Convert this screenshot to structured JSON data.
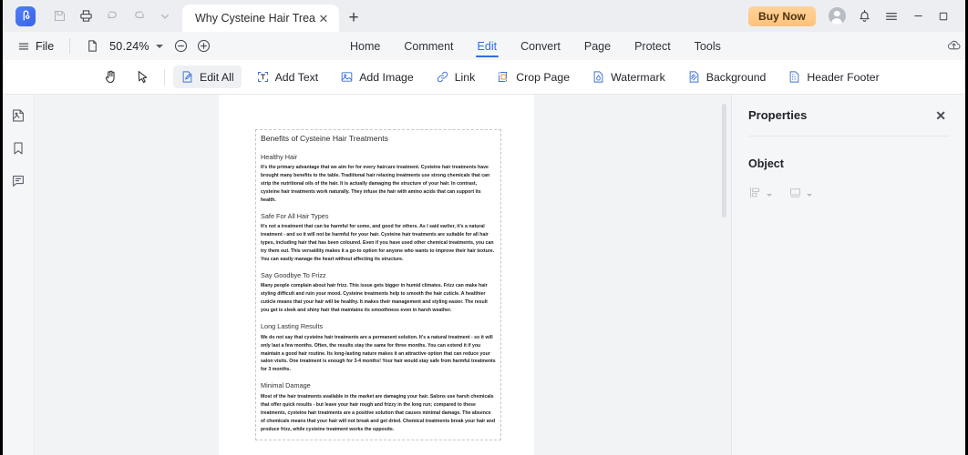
{
  "window": {
    "titlebar": {
      "logo_icon": "pdfelement-logo-icon",
      "quick_actions": [
        {
          "name": "save-icon",
          "label": "Save",
          "enabled": false
        },
        {
          "name": "print-icon",
          "label": "Print",
          "enabled": true
        },
        {
          "name": "undo-icon",
          "label": "Undo",
          "enabled": false
        },
        {
          "name": "redo-icon",
          "label": "Redo",
          "enabled": false
        },
        {
          "name": "chevron-down-icon",
          "label": "More",
          "enabled": true
        }
      ],
      "tab": {
        "title": "Why Cysteine Hair Treat...",
        "close_label": "✕"
      },
      "new_tab_label": "+",
      "buy_now_label": "Buy Now",
      "account_icon": "account-avatar-icon",
      "notification_icon": "bell-icon",
      "menu_icon": "hamburger-menu-icon",
      "minimize_label": "—",
      "maximize_label": "□"
    },
    "menubar": {
      "file_label": "File",
      "page_fit_icon": "page-fit-icon",
      "zoom_value": "50.24%",
      "zoom_out_label": "−",
      "zoom_in_label": "+",
      "cloud_icon": "cloud-upload-icon",
      "ribbon_tabs": [
        {
          "label": "Home",
          "active": false
        },
        {
          "label": "Comment",
          "active": false
        },
        {
          "label": "Edit",
          "active": true
        },
        {
          "label": "Convert",
          "active": false
        },
        {
          "label": "Page",
          "active": false
        },
        {
          "label": "Protect",
          "active": false
        },
        {
          "label": "Tools",
          "active": false
        }
      ]
    },
    "toolbar": {
      "hand_tool_label": "Hand",
      "select_tool_label": "Select",
      "items": [
        {
          "label": "Edit All",
          "icon": "edit-all-icon",
          "selected": true
        },
        {
          "label": "Add Text",
          "icon": "add-text-icon",
          "selected": false
        },
        {
          "label": "Add Image",
          "icon": "add-image-icon",
          "selected": false
        },
        {
          "label": "Link",
          "icon": "link-icon",
          "selected": false
        },
        {
          "label": "Crop Page",
          "icon": "crop-page-icon",
          "selected": false
        },
        {
          "label": "Watermark",
          "icon": "watermark-icon",
          "selected": false
        },
        {
          "label": "Background",
          "icon": "background-icon",
          "selected": false
        },
        {
          "label": "Header Footer",
          "icon": "header-footer-icon",
          "selected": false
        }
      ]
    },
    "left_rail": [
      {
        "name": "thumbnails-icon",
        "label": "Thumbnails"
      },
      {
        "name": "bookmark-icon",
        "label": "Bookmarks"
      },
      {
        "name": "comment-icon",
        "label": "Comments"
      }
    ],
    "right_panel": {
      "title": "Properties",
      "close_label": "✕",
      "section_title": "Object",
      "controls": [
        {
          "name": "align-objects-dropdown",
          "icon": "align-icon"
        },
        {
          "name": "distribute-objects-dropdown",
          "icon": "distribute-icon"
        }
      ]
    }
  },
  "document": {
    "title": "Benefits of Cysteine Hair Treatments",
    "sections": [
      {
        "heading": "Healthy Hair",
        "body": "It's the primary advantage that we aim for for every haircare treatment. Cysteine hair treatments have brought many benefits to the table. Traditional hair relaxing treatments use strong chemicals that can strip the nutritional oils of the hair. It is actually damaging the structure of your hair. In contrast, cysteine hair treatments work naturally. They infuse the hair with amino acids that can support its health."
      },
      {
        "heading": "Safe For All Hair Types",
        "body": "It's not a treatment that can be harmful for some, and good for others. As I said earlier, it's a natural treatment - and so it will not be harmful for your hair. Cysteine hair treatments are suitable for all hair types, including hair that has been coloured. Even if you have used other chemical treatments, you can try them out. This versatility makes it a go-to option for anyone who wants to improve their hair texture. You can easily manage the heart without affecting its structure."
      },
      {
        "heading": "Say Goodbye To Frizz",
        "body": "Many people complain about hair frizz. This issue gets bigger in humid climates. Frizz can make hair styling difficult and ruin your mood. Cysteine treatments help to smooth the hair cuticle. A healthier cuticle means that your hair will be healthy. It makes their management and styling easier. The result you get is sleek and shiny hair that maintains its smoothness even in harsh weather."
      },
      {
        "heading": "Long Lasting Results",
        "body": "We do not say that cysteine hair treatments are a permanent solution. It's a natural treatment - so it will only last a few months. Often, the results stay the same for three months. You can extend it if you maintain a good hair routine. Its long-lasting nature makes it an attractive option that can reduce your salon visits. One treatment is enough for 3-4 months! Your hair would stay safe from harmful treatments for 3 months."
      },
      {
        "heading": "Minimal Damage",
        "body": "Most of the hair treatments available in the market are damaging your hair. Salons use harsh chemicals that offer quick results - but leave your hair rough and frizzy in the long run; compared to these treatments, cysteine hair treatments are a positive solution that causes minimal damage. The absence of chemicals means that your hair will not break and get dried. Chemical treatments break your hair and produce frizz, while cysteine treatment works the opposite."
      }
    ]
  },
  "colors": {
    "accent": "#2f6fe4",
    "buy_now": "#ffc27a",
    "titlebar_bg": "#eceef2",
    "panel_bg": "#f5f6f8",
    "canvas_bg": "#f2f3f5"
  }
}
